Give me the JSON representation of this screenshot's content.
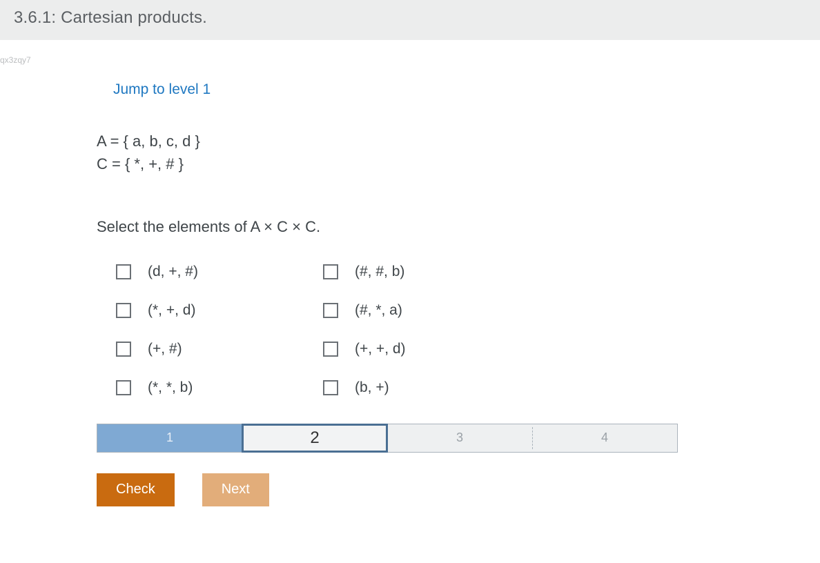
{
  "header": {
    "title": "3.6.1: Cartesian products."
  },
  "watermark": "qx3zqy7",
  "jump_link": "Jump to level 1",
  "sets": {
    "line1": "A = { a, b, c, d }",
    "line2": "C = { *, +, # }"
  },
  "prompt": "Select the elements of A × C × C.",
  "options": {
    "left": [
      "(d, +, #)",
      "(*, +, d)",
      "(+, #)",
      "(*, *, b)"
    ],
    "right": [
      "(#, #, b)",
      "(#, *, a)",
      "(+, +, d)",
      "(b, +)"
    ]
  },
  "levels": [
    "1",
    "2",
    "3",
    "4"
  ],
  "level_state": {
    "done_index": 0,
    "current_index": 1
  },
  "buttons": {
    "check": "Check",
    "next": "Next"
  }
}
